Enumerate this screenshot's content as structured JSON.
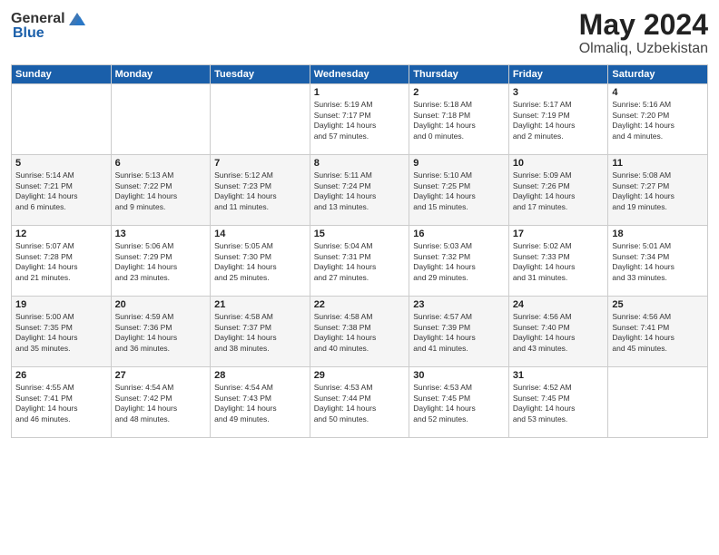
{
  "logo": {
    "general": "General",
    "blue": "Blue"
  },
  "title": "May 2024",
  "subtitle": "Olmaliq, Uzbekistan",
  "days_of_week": [
    "Sunday",
    "Monday",
    "Tuesday",
    "Wednesday",
    "Thursday",
    "Friday",
    "Saturday"
  ],
  "weeks": [
    [
      {
        "day": "",
        "info": ""
      },
      {
        "day": "",
        "info": ""
      },
      {
        "day": "",
        "info": ""
      },
      {
        "day": "1",
        "info": "Sunrise: 5:19 AM\nSunset: 7:17 PM\nDaylight: 14 hours\nand 57 minutes."
      },
      {
        "day": "2",
        "info": "Sunrise: 5:18 AM\nSunset: 7:18 PM\nDaylight: 14 hours\nand 0 minutes."
      },
      {
        "day": "3",
        "info": "Sunrise: 5:17 AM\nSunset: 7:19 PM\nDaylight: 14 hours\nand 2 minutes."
      },
      {
        "day": "4",
        "info": "Sunrise: 5:16 AM\nSunset: 7:20 PM\nDaylight: 14 hours\nand 4 minutes."
      }
    ],
    [
      {
        "day": "5",
        "info": "Sunrise: 5:14 AM\nSunset: 7:21 PM\nDaylight: 14 hours\nand 6 minutes."
      },
      {
        "day": "6",
        "info": "Sunrise: 5:13 AM\nSunset: 7:22 PM\nDaylight: 14 hours\nand 9 minutes."
      },
      {
        "day": "7",
        "info": "Sunrise: 5:12 AM\nSunset: 7:23 PM\nDaylight: 14 hours\nand 11 minutes."
      },
      {
        "day": "8",
        "info": "Sunrise: 5:11 AM\nSunset: 7:24 PM\nDaylight: 14 hours\nand 13 minutes."
      },
      {
        "day": "9",
        "info": "Sunrise: 5:10 AM\nSunset: 7:25 PM\nDaylight: 14 hours\nand 15 minutes."
      },
      {
        "day": "10",
        "info": "Sunrise: 5:09 AM\nSunset: 7:26 PM\nDaylight: 14 hours\nand 17 minutes."
      },
      {
        "day": "11",
        "info": "Sunrise: 5:08 AM\nSunset: 7:27 PM\nDaylight: 14 hours\nand 19 minutes."
      }
    ],
    [
      {
        "day": "12",
        "info": "Sunrise: 5:07 AM\nSunset: 7:28 PM\nDaylight: 14 hours\nand 21 minutes."
      },
      {
        "day": "13",
        "info": "Sunrise: 5:06 AM\nSunset: 7:29 PM\nDaylight: 14 hours\nand 23 minutes."
      },
      {
        "day": "14",
        "info": "Sunrise: 5:05 AM\nSunset: 7:30 PM\nDaylight: 14 hours\nand 25 minutes."
      },
      {
        "day": "15",
        "info": "Sunrise: 5:04 AM\nSunset: 7:31 PM\nDaylight: 14 hours\nand 27 minutes."
      },
      {
        "day": "16",
        "info": "Sunrise: 5:03 AM\nSunset: 7:32 PM\nDaylight: 14 hours\nand 29 minutes."
      },
      {
        "day": "17",
        "info": "Sunrise: 5:02 AM\nSunset: 7:33 PM\nDaylight: 14 hours\nand 31 minutes."
      },
      {
        "day": "18",
        "info": "Sunrise: 5:01 AM\nSunset: 7:34 PM\nDaylight: 14 hours\nand 33 minutes."
      }
    ],
    [
      {
        "day": "19",
        "info": "Sunrise: 5:00 AM\nSunset: 7:35 PM\nDaylight: 14 hours\nand 35 minutes."
      },
      {
        "day": "20",
        "info": "Sunrise: 4:59 AM\nSunset: 7:36 PM\nDaylight: 14 hours\nand 36 minutes."
      },
      {
        "day": "21",
        "info": "Sunrise: 4:58 AM\nSunset: 7:37 PM\nDaylight: 14 hours\nand 38 minutes."
      },
      {
        "day": "22",
        "info": "Sunrise: 4:58 AM\nSunset: 7:38 PM\nDaylight: 14 hours\nand 40 minutes."
      },
      {
        "day": "23",
        "info": "Sunrise: 4:57 AM\nSunset: 7:39 PM\nDaylight: 14 hours\nand 41 minutes."
      },
      {
        "day": "24",
        "info": "Sunrise: 4:56 AM\nSunset: 7:40 PM\nDaylight: 14 hours\nand 43 minutes."
      },
      {
        "day": "25",
        "info": "Sunrise: 4:56 AM\nSunset: 7:41 PM\nDaylight: 14 hours\nand 45 minutes."
      }
    ],
    [
      {
        "day": "26",
        "info": "Sunrise: 4:55 AM\nSunset: 7:41 PM\nDaylight: 14 hours\nand 46 minutes."
      },
      {
        "day": "27",
        "info": "Sunrise: 4:54 AM\nSunset: 7:42 PM\nDaylight: 14 hours\nand 48 minutes."
      },
      {
        "day": "28",
        "info": "Sunrise: 4:54 AM\nSunset: 7:43 PM\nDaylight: 14 hours\nand 49 minutes."
      },
      {
        "day": "29",
        "info": "Sunrise: 4:53 AM\nSunset: 7:44 PM\nDaylight: 14 hours\nand 50 minutes."
      },
      {
        "day": "30",
        "info": "Sunrise: 4:53 AM\nSunset: 7:45 PM\nDaylight: 14 hours\nand 52 minutes."
      },
      {
        "day": "31",
        "info": "Sunrise: 4:52 AM\nSunset: 7:45 PM\nDaylight: 14 hours\nand 53 minutes."
      },
      {
        "day": "",
        "info": ""
      }
    ]
  ]
}
